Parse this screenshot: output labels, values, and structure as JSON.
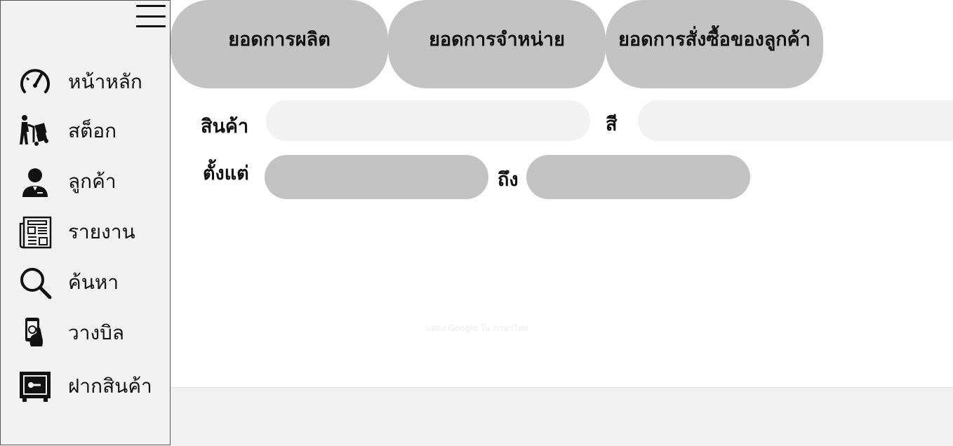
{
  "sidebar": {
    "menu_icon": "hamburger-menu-icon",
    "items": [
      {
        "label": "หน้าหลัก",
        "icon": "speedometer-icon"
      },
      {
        "label": "สต็อก",
        "icon": "hand-truck-icon"
      },
      {
        "label": "ลูกค้า",
        "icon": "customer-icon"
      },
      {
        "label": "รายงาน",
        "icon": "newspaper-icon"
      },
      {
        "label": "ค้นหา",
        "icon": "search-icon"
      },
      {
        "label": "วางบิล",
        "icon": "hand-money-icon"
      },
      {
        "label": "ฝากสินค้า",
        "icon": "safe-icon"
      }
    ]
  },
  "tabs": [
    {
      "label": "ยอดการผลิต"
    },
    {
      "label": "ยอดการจำหน่าย"
    },
    {
      "label": "ยอดการสั่งซื้อของลูกค้า"
    }
  ],
  "filters": {
    "product_label": "สินค้า",
    "product_value": "",
    "color_label": "สี",
    "color_value": "",
    "from_label": "ตั้งแต่",
    "from_value": "",
    "to_label": "ถึง",
    "to_value": ""
  },
  "watermark": "แสดง Google ใน ภาษาไทย",
  "colors": {
    "tab_bg": "#c3c3c3",
    "sidebar_bg": "#f2f2f2",
    "input_light": "#f2f2f2",
    "input_dark": "#c3c3c3"
  }
}
